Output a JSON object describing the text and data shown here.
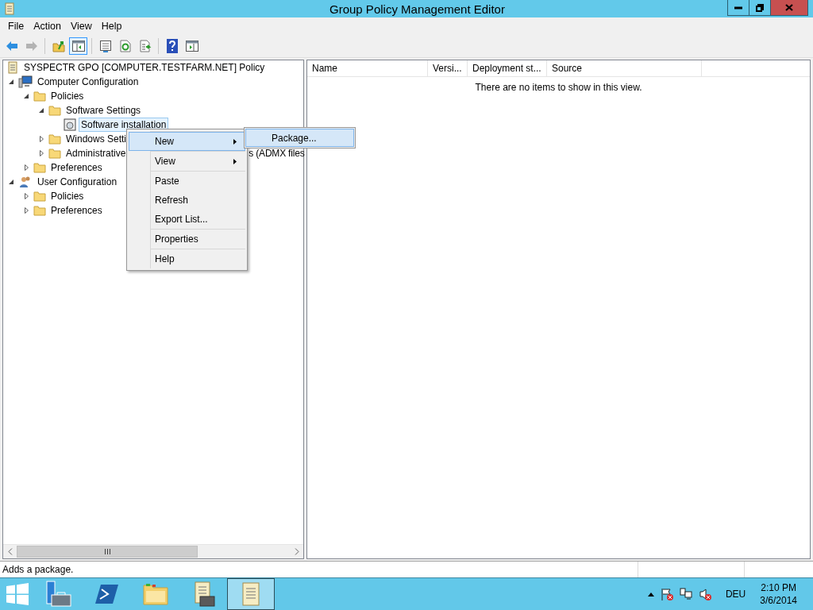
{
  "window": {
    "title": "Group Policy Management Editor"
  },
  "window_controls": [
    {
      "kind": "minimize"
    },
    {
      "kind": "restore"
    },
    {
      "kind": "close"
    }
  ],
  "menu_bar": [
    "File",
    "Action",
    "View",
    "Help"
  ],
  "toolbar": [
    {
      "kind": "back",
      "disabled": false,
      "pressed": false
    },
    {
      "kind": "forward",
      "disabled": true,
      "pressed": false
    },
    {
      "kind": "separator"
    },
    {
      "kind": "up-folder",
      "disabled": false,
      "pressed": false
    },
    {
      "kind": "console-tree",
      "disabled": false,
      "pressed": true
    },
    {
      "kind": "separator"
    },
    {
      "kind": "properties",
      "disabled": false,
      "pressed": false
    },
    {
      "kind": "refresh",
      "disabled": false,
      "pressed": false
    },
    {
      "kind": "export",
      "disabled": false,
      "pressed": false
    },
    {
      "kind": "separator"
    },
    {
      "kind": "help",
      "disabled": false,
      "pressed": false
    },
    {
      "kind": "action-pane",
      "disabled": false,
      "pressed": false
    }
  ],
  "tree": {
    "root": {
      "label": "SYSPECTR GPO [COMPUTER.TESTFARM.NET] Policy",
      "selected": false
    },
    "items": [
      {
        "label": "Computer Configuration",
        "kind": "computer",
        "expanded": true,
        "selected": false,
        "children": [
          {
            "label": "Policies",
            "kind": "folder",
            "expanded": true,
            "selected": false,
            "children": [
              {
                "label": "Software Settings",
                "kind": "folder",
                "expanded": true,
                "selected": false,
                "children": [
                  {
                    "label": "Software installation",
                    "kind": "installer",
                    "selected": true
                  }
                ]
              },
              {
                "label": "Windows Setti",
                "kind": "folder",
                "expanded": false,
                "selected": false
              },
              {
                "label": "Administrative",
                "label_tail": "s (ADMX files",
                "kind": "folder",
                "expanded": false,
                "selected": false
              }
            ]
          },
          {
            "label": "Preferences",
            "kind": "folder",
            "expanded": false,
            "selected": false
          }
        ]
      },
      {
        "label": "User Configuration",
        "kind": "user",
        "expanded": true,
        "selected": false,
        "children": [
          {
            "label": "Policies",
            "kind": "folder",
            "expanded": false,
            "selected": false
          },
          {
            "label": "Preferences",
            "kind": "folder",
            "expanded": false,
            "selected": false
          }
        ]
      }
    ]
  },
  "context_menu": {
    "groups": [
      [
        {
          "label": "New",
          "submenu": true,
          "selected": true
        }
      ],
      [
        {
          "label": "View",
          "submenu": true,
          "selected": false
        }
      ],
      [
        {
          "label": "Paste",
          "submenu": false,
          "selected": false
        },
        {
          "label": "Refresh",
          "submenu": false,
          "selected": false
        },
        {
          "label": "Export List...",
          "submenu": false,
          "selected": false
        }
      ],
      [
        {
          "label": "Properties",
          "submenu": false,
          "selected": false
        }
      ],
      [
        {
          "label": "Help",
          "submenu": false,
          "selected": false
        }
      ]
    ]
  },
  "submenu": {
    "items": [
      {
        "label": "Package...",
        "selected": true
      }
    ]
  },
  "list": {
    "columns": [
      "Name",
      "Versi...",
      "Deployment st...",
      "Source"
    ],
    "empty_message": "There are no items to show in this view."
  },
  "status_bar": {
    "text": "Adds a package."
  },
  "taskbar": {
    "apps": [
      {
        "kind": "start",
        "selected": false
      },
      {
        "kind": "server-manager",
        "selected": false
      },
      {
        "kind": "powershell",
        "selected": false
      },
      {
        "kind": "explorer",
        "selected": false
      },
      {
        "kind": "gpmc",
        "selected": false
      },
      {
        "kind": "gpedit",
        "selected": true
      }
    ],
    "tray": {
      "icons": [
        {
          "kind": "flag",
          "alert": true
        },
        {
          "kind": "network",
          "alert": false
        },
        {
          "kind": "speaker",
          "alert": true
        }
      ],
      "language": "DEU",
      "time": "2:10 PM",
      "date": "3/6/2014"
    }
  }
}
